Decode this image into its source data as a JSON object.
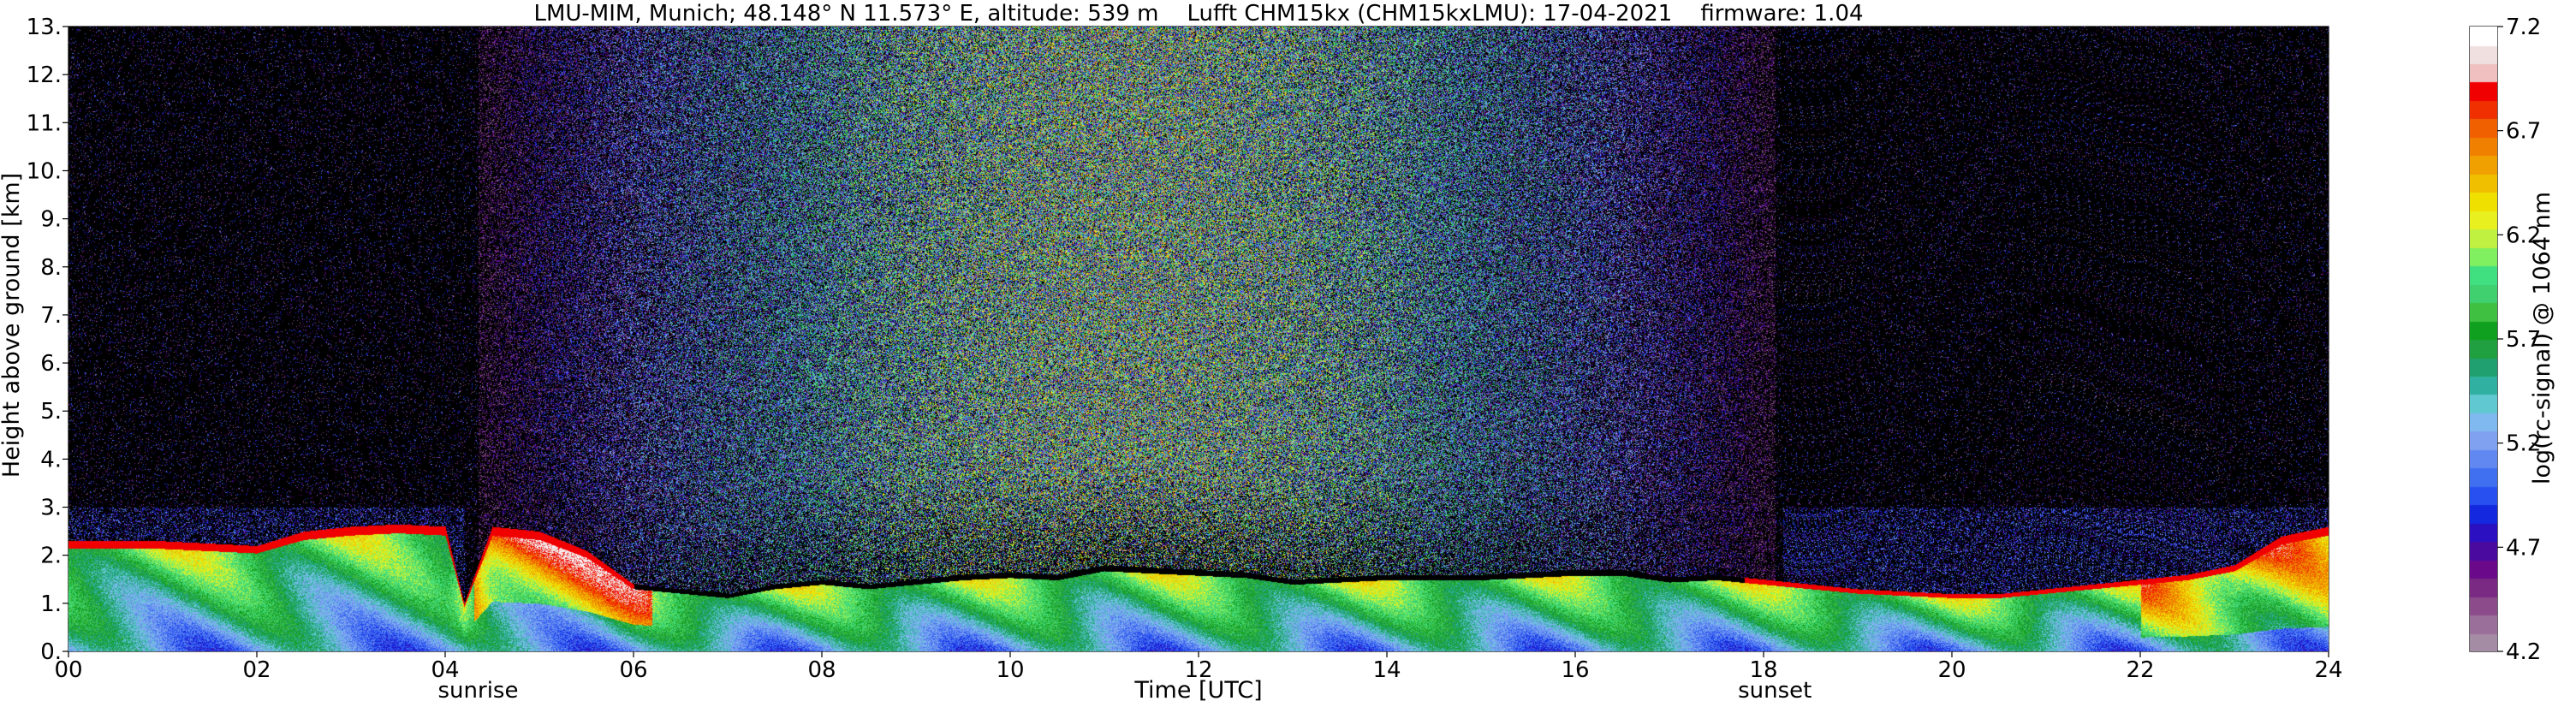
{
  "chart_data": {
    "type": "heatmap",
    "title": "LMU-MIM, Munich; 48.148° N 11.573° E, altitude: 539 m    Lufft CHM15kx (CHM15kxLMU): 17-04-2021    firmware: 1.04",
    "xlabel": "Time [UTC]",
    "ylabel": "Height above ground [km]",
    "xlim": [
      0,
      24
    ],
    "ylim": [
      0,
      13
    ],
    "x_ticks": [
      0,
      2,
      4,
      6,
      8,
      10,
      12,
      14,
      16,
      18,
      20,
      22,
      24
    ],
    "x_tick_labels": [
      "00",
      "02",
      "04",
      "06",
      "08",
      "10",
      "12",
      "14",
      "16",
      "18",
      "20",
      "22",
      "24"
    ],
    "y_ticks": [
      0,
      1,
      2,
      3,
      4,
      5,
      6,
      7,
      8,
      9,
      10,
      11,
      12,
      13
    ],
    "y_tick_labels": [
      "0.",
      "1.",
      "2.",
      "3.",
      "4.",
      "5.",
      "6.",
      "7.",
      "8.",
      "9.",
      "10.",
      "11.",
      "12.",
      "13."
    ],
    "grid": true,
    "events": [
      {
        "label": "sunrise",
        "x": 4.35
      },
      {
        "label": "sunset",
        "x": 18.12
      }
    ],
    "colorbar": {
      "label": "log(rc-signal) @ 1064 nm",
      "range": [
        4.2,
        7.2
      ],
      "ticks": [
        4.2,
        4.7,
        5.2,
        5.7,
        6.2,
        6.7,
        7.2
      ],
      "tick_labels": [
        "4.2",
        "4.7",
        "5.2",
        "5.7",
        "6.2",
        "6.7",
        "7.2"
      ],
      "colors": [
        "#a58ca5",
        "#9a6f9a",
        "#8c4c8c",
        "#7a2a82",
        "#6a0a8a",
        "#4a0aa0",
        "#2a10c0",
        "#1428e0",
        "#2850f0",
        "#4070f0",
        "#6088f0",
        "#80a0f0",
        "#80b8f0",
        "#60c8d0",
        "#30b0a0",
        "#20a070",
        "#20a040",
        "#10a020",
        "#40c040",
        "#40d070",
        "#40e080",
        "#80f060",
        "#c0f040",
        "#e8f020",
        "#f0e000",
        "#f0c000",
        "#f0a000",
        "#f08000",
        "#f06000",
        "#f03000",
        "#f00000",
        "#f0c0c0",
        "#f0e0e0",
        "#ffffff"
      ]
    },
    "profiles": {
      "x": [
        0,
        1,
        2,
        2.5,
        3,
        3.5,
        4,
        4.2,
        4.5,
        5,
        5.5,
        6,
        6.5,
        7,
        7.5,
        8,
        8.5,
        9,
        9.5,
        10,
        10.5,
        11,
        11.5,
        12,
        12.5,
        13,
        13.5,
        14,
        14.5,
        15,
        15.5,
        16,
        16.5,
        17,
        17.5,
        18,
        18.5,
        19,
        19.5,
        20,
        20.5,
        21,
        21.5,
        22,
        22.5,
        23,
        23.5,
        24
      ],
      "boundary_layer_top_km": [
        2.3,
        2.3,
        2.2,
        2.5,
        2.6,
        2.65,
        2.6,
        1.0,
        2.6,
        2.5,
        2.1,
        1.4,
        1.3,
        1.2,
        1.4,
        1.5,
        1.4,
        1.5,
        1.6,
        1.65,
        1.6,
        1.8,
        1.75,
        1.7,
        1.65,
        1.5,
        1.55,
        1.6,
        1.6,
        1.6,
        1.65,
        1.7,
        1.7,
        1.55,
        1.6,
        1.5,
        1.4,
        1.3,
        1.25,
        1.2,
        1.2,
        1.3,
        1.4,
        1.5,
        1.6,
        1.8,
        2.4,
        2.6
      ]
    }
  }
}
